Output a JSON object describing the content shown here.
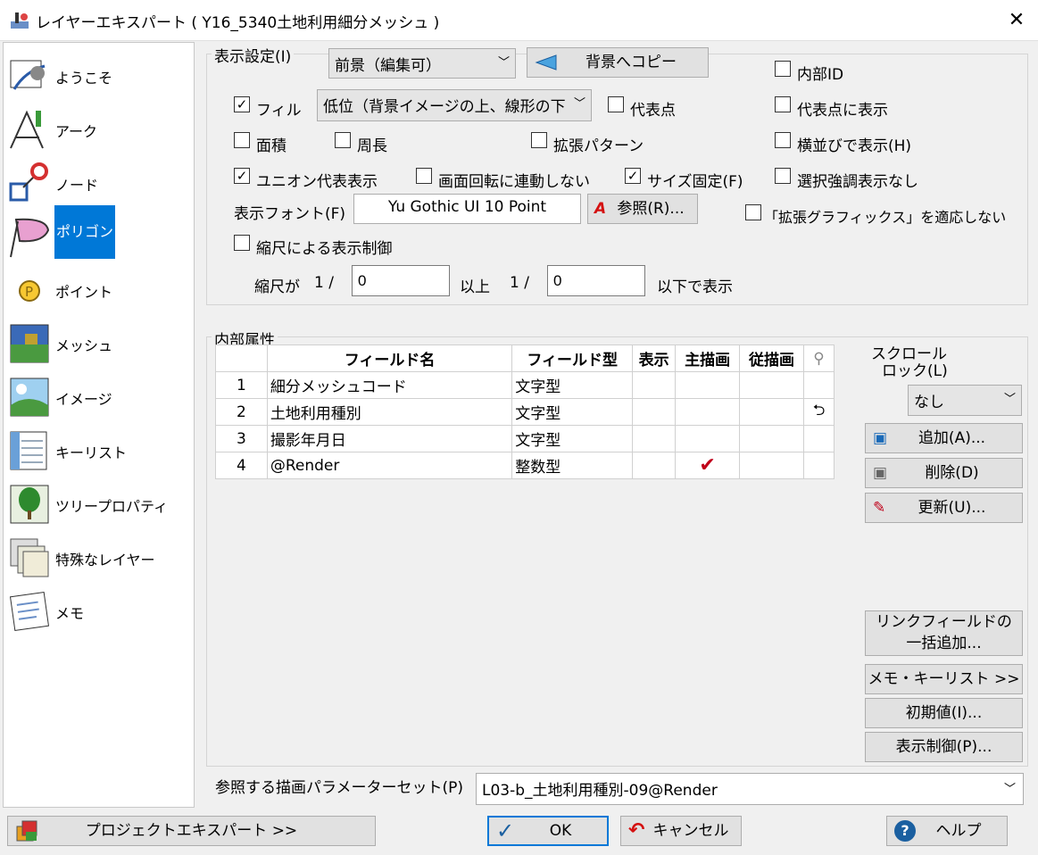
{
  "window": {
    "title": "レイヤーエキスパート ( Y16_5340土地利用細分メッシュ )",
    "close": "✕"
  },
  "sidebar": {
    "items": [
      {
        "label": "ようこそ",
        "icon": "welcome-icon"
      },
      {
        "label": "アーク",
        "icon": "arc-icon"
      },
      {
        "label": "ノード",
        "icon": "node-icon"
      },
      {
        "label": "ポリゴン",
        "icon": "polygon-icon",
        "selected": true
      },
      {
        "label": "ポイント",
        "icon": "point-icon"
      },
      {
        "label": "メッシュ",
        "icon": "mesh-icon"
      },
      {
        "label": "イメージ",
        "icon": "image-icon"
      },
      {
        "label": "キーリスト",
        "icon": "keylist-icon"
      },
      {
        "label": "ツリープロパティ",
        "icon": "tree-icon"
      },
      {
        "label": "特殊なレイヤー",
        "icon": "special-layer-icon"
      },
      {
        "label": "メモ",
        "icon": "memo-icon"
      }
    ]
  },
  "display": {
    "group_title": "表示設定(I)",
    "layer_select": "前景（編集可）",
    "copy_button": "背景へコピー",
    "fill_label": "フィル",
    "fill_select": "低位（背景イメージの上、線形の下",
    "area_label": "面積",
    "perimeter_label": "周長",
    "union_label": "ユニオン代表表示",
    "no_rotate_label": "画面回転に連動しない",
    "size_fixed_label": "サイズ固定(F)",
    "font_label": "表示フォント(F)",
    "font_value": "Yu Gothic UI 10 Point",
    "browse_button": "参照(R)...",
    "scale_control_label": "縮尺による表示制御",
    "scale_prefix": "縮尺が",
    "scale_one_a": "1 /",
    "scale_min": "0",
    "scale_mid": "以上",
    "scale_one_b": "1 /",
    "scale_max": "0",
    "scale_suffix": "以下で表示",
    "rep_point_label": "代表点",
    "ext_pattern_label": "拡張パターン",
    "internal_id_label": "内部ID",
    "show_at_rep_label": "代表点に表示",
    "side_by_side_label": "横並びで表示(H)",
    "no_highlight_label": "選択強調表示なし",
    "no_ext_graphics_label": "「拡張グラフィックス」を適応しない",
    "checks": {
      "fill": "✓",
      "union": "✓",
      "size_fixed": "✓"
    }
  },
  "attributes": {
    "group_title": "内部属性",
    "columns": [
      "フィールド名",
      "フィールド型",
      "表示",
      "主描画",
      "従描画"
    ],
    "rows": [
      {
        "n": "1",
        "name": "細分メッシュコード",
        "type": "文字型",
        "main": "",
        "link": ""
      },
      {
        "n": "2",
        "name": "土地利用種別",
        "type": "文字型",
        "main": "",
        "link": "⮌"
      },
      {
        "n": "3",
        "name": "撮影年月日",
        "type": "文字型",
        "main": "",
        "link": ""
      },
      {
        "n": "4",
        "name": "@Render",
        "type": "整数型",
        "main": "✔",
        "link": ""
      }
    ],
    "scroll_lock_label_1": "スクロール",
    "scroll_lock_label_2": "ロック(L)",
    "scroll_lock_value": "なし",
    "add_button": "追加(A)...",
    "delete_button": "削除(D)",
    "update_button": "更新(U)...",
    "link_add_1": "リンクフィールドの",
    "link_add_2": "一括追加...",
    "memo_keylist_button": "メモ・キーリスト >>",
    "initial_value_button": "初期値(I)...",
    "display_control_button": "表示制御(P)..."
  },
  "param_set": {
    "label": "参照する描画パラメーターセット(P)",
    "value": "L03-b_土地利用種別-09@Render"
  },
  "footer": {
    "project_button": "プロジェクトエキスパート >>",
    "ok_button": "OK",
    "cancel_button": "キャンセル",
    "help_button": "ヘルプ"
  },
  "colors": {
    "accent": "#0078d7",
    "polygon_fill": "#e8a0d0",
    "check_red": "#c0001a"
  }
}
